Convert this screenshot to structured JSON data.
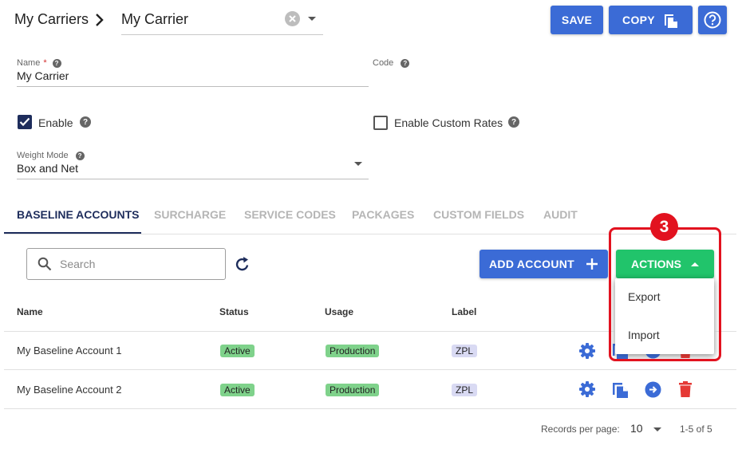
{
  "header": {
    "breadcrumb": "My Carriers",
    "carrier_select": "My Carrier",
    "save_label": "SAVE",
    "copy_label": "COPY"
  },
  "form": {
    "name_label": "Name",
    "name_required": "*",
    "name_value": "My Carrier",
    "code_label": "Code",
    "code_value": "",
    "enable_label": "Enable",
    "enable_checked": true,
    "custom_rates_label": "Enable Custom Rates",
    "custom_rates_checked": false,
    "weight_mode_label": "Weight Mode",
    "weight_mode_value": "Box and Net"
  },
  "tabs": [
    {
      "label": "BASELINE ACCOUNTS",
      "active": true
    },
    {
      "label": "SURCHARGE",
      "active": false
    },
    {
      "label": "SERVICE CODES",
      "active": false
    },
    {
      "label": "PACKAGES",
      "active": false
    },
    {
      "label": "CUSTOM FIELDS",
      "active": false
    },
    {
      "label": "AUDIT",
      "active": false
    }
  ],
  "toolbar": {
    "search_placeholder": "Search",
    "add_account_label": "ADD ACCOUNT",
    "actions_label": "ACTIONS",
    "menu_items": [
      "Export",
      "Import"
    ],
    "step_badge": "3"
  },
  "table": {
    "columns": [
      "Name",
      "Status",
      "Usage",
      "Label"
    ],
    "rows": [
      {
        "name": "My Baseline Account 1",
        "status": "Active",
        "usage": "Production",
        "label": "ZPL"
      },
      {
        "name": "My Baseline Account 2",
        "status": "Active",
        "usage": "Production",
        "label": "ZPL"
      }
    ]
  },
  "pagination": {
    "records_label": "Records per page:",
    "per_page": "10",
    "range": "1-5 of 5"
  },
  "colors": {
    "primary": "#3b6bd6",
    "navy": "#1e2d5c",
    "actions_green": "#21c46b",
    "highlight_red": "#e2121f",
    "delete_red": "#e53935",
    "active_chip": "#7fd28b",
    "label_chip": "#d9daf3"
  }
}
